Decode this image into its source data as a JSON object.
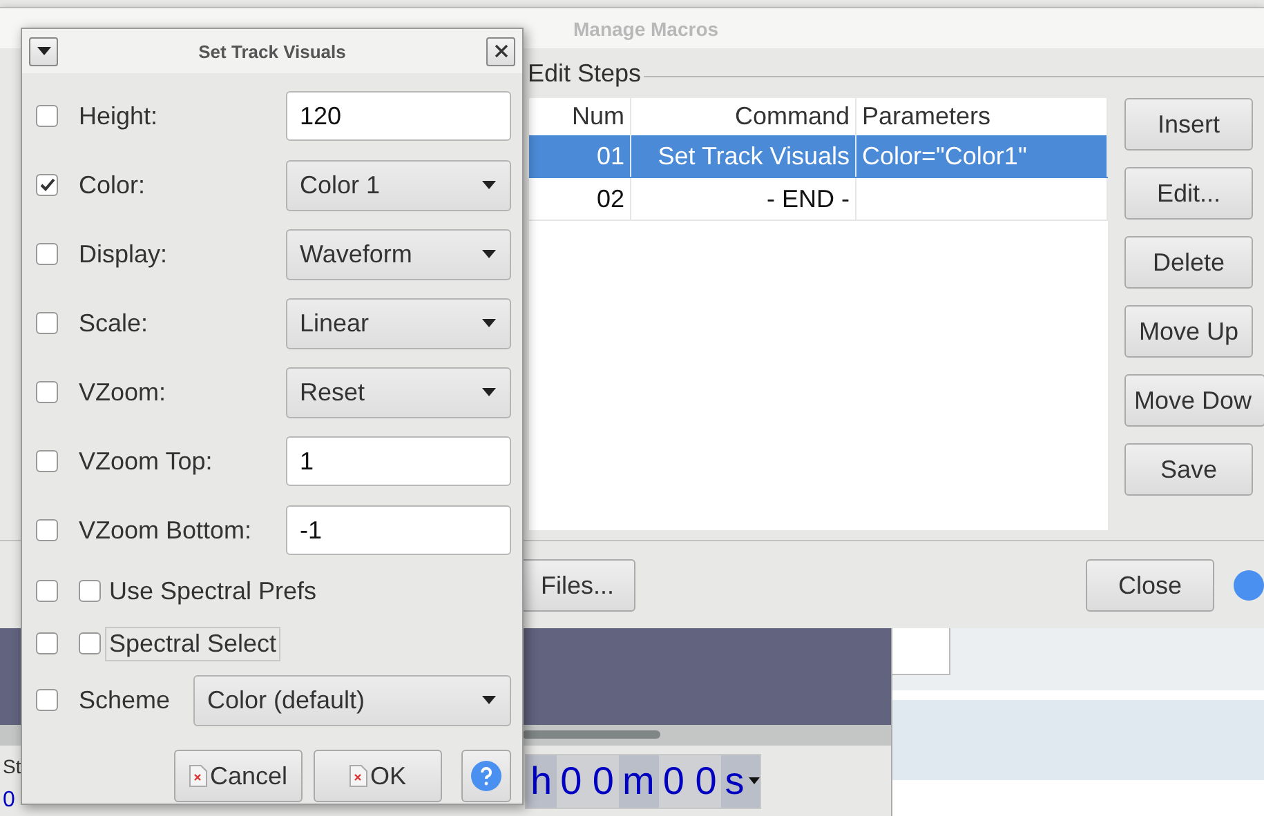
{
  "manage_macros": {
    "title": "Manage Macros",
    "group_title": "Edit Steps",
    "table": {
      "columns": [
        "Num",
        "Command",
        "Parameters"
      ],
      "rows": [
        {
          "num": "01",
          "command": "Set Track Visuals",
          "parameters": "Color=\"Color1\"",
          "selected": true
        },
        {
          "num": "02",
          "command": "- END -",
          "selected": false
        }
      ]
    },
    "side_buttons": [
      "Insert",
      "Edit...",
      "Delete",
      "Move Up",
      "Move Dow",
      "Save"
    ],
    "footer_buttons": [
      "Files...",
      "Close"
    ]
  },
  "time_control": {
    "segments": [
      {
        "text": "h",
        "kind": "unit"
      },
      {
        "text": "0 0",
        "kind": "digits"
      },
      {
        "text": "m",
        "kind": "unit"
      },
      {
        "text": "0 0",
        "kind": "digits"
      },
      {
        "text": "s",
        "kind": "unit"
      }
    ]
  },
  "left_fragments": [
    "St",
    "0"
  ],
  "dialog": {
    "title": "Set Track Visuals",
    "rows": [
      {
        "kind": "text",
        "label": "Height:",
        "enabled": false,
        "value": "120"
      },
      {
        "kind": "choice",
        "label": "Color:",
        "enabled": true,
        "value": "Color 1"
      },
      {
        "kind": "choice",
        "label": "Display:",
        "enabled": false,
        "value": "Waveform"
      },
      {
        "kind": "choice",
        "label": "Scale:",
        "enabled": false,
        "value": "Linear"
      },
      {
        "kind": "choice",
        "label": "VZoom:",
        "enabled": false,
        "value": "Reset"
      },
      {
        "kind": "text",
        "label": "VZoom Top:",
        "enabled": false,
        "value": "1"
      },
      {
        "kind": "text",
        "label": "VZoom Bottom:",
        "enabled": false,
        "value": "-1"
      },
      {
        "kind": "checkbox",
        "label": "Use Spectral Prefs",
        "enabled": false,
        "checked": false,
        "focused": false
      },
      {
        "kind": "checkbox",
        "label": "Spectral Select",
        "enabled": false,
        "checked": false,
        "focused": true
      },
      {
        "kind": "wide_choice",
        "label": "Scheme",
        "enabled": false,
        "value": "Color (default)"
      }
    ],
    "buttons": [
      "Cancel",
      "OK"
    ]
  }
}
